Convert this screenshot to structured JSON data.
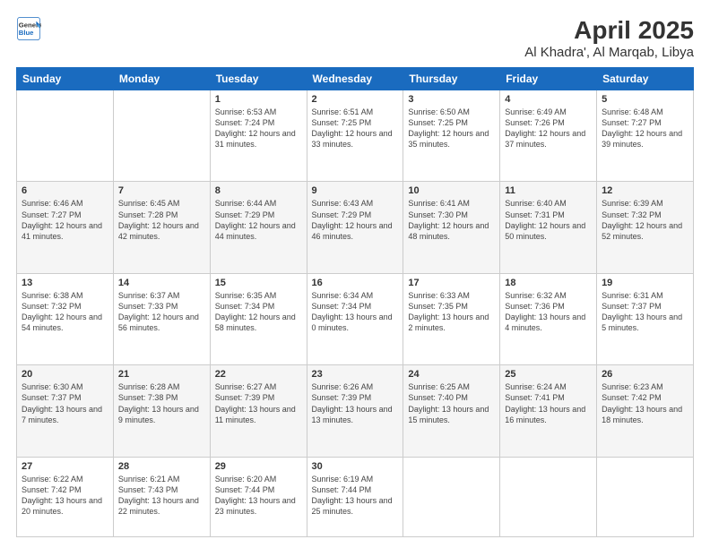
{
  "logo": {
    "line1": "General",
    "line2": "Blue"
  },
  "title": "April 2025",
  "subtitle": "Al Khadra', Al Marqab, Libya",
  "days": [
    "Sunday",
    "Monday",
    "Tuesday",
    "Wednesday",
    "Thursday",
    "Friday",
    "Saturday"
  ],
  "weeks": [
    [
      {
        "day": "",
        "sunrise": "",
        "sunset": "",
        "daylight": ""
      },
      {
        "day": "",
        "sunrise": "",
        "sunset": "",
        "daylight": ""
      },
      {
        "day": "1",
        "sunrise": "Sunrise: 6:53 AM",
        "sunset": "Sunset: 7:24 PM",
        "daylight": "Daylight: 12 hours and 31 minutes."
      },
      {
        "day": "2",
        "sunrise": "Sunrise: 6:51 AM",
        "sunset": "Sunset: 7:25 PM",
        "daylight": "Daylight: 12 hours and 33 minutes."
      },
      {
        "day": "3",
        "sunrise": "Sunrise: 6:50 AM",
        "sunset": "Sunset: 7:25 PM",
        "daylight": "Daylight: 12 hours and 35 minutes."
      },
      {
        "day": "4",
        "sunrise": "Sunrise: 6:49 AM",
        "sunset": "Sunset: 7:26 PM",
        "daylight": "Daylight: 12 hours and 37 minutes."
      },
      {
        "day": "5",
        "sunrise": "Sunrise: 6:48 AM",
        "sunset": "Sunset: 7:27 PM",
        "daylight": "Daylight: 12 hours and 39 minutes."
      }
    ],
    [
      {
        "day": "6",
        "sunrise": "Sunrise: 6:46 AM",
        "sunset": "Sunset: 7:27 PM",
        "daylight": "Daylight: 12 hours and 41 minutes."
      },
      {
        "day": "7",
        "sunrise": "Sunrise: 6:45 AM",
        "sunset": "Sunset: 7:28 PM",
        "daylight": "Daylight: 12 hours and 42 minutes."
      },
      {
        "day": "8",
        "sunrise": "Sunrise: 6:44 AM",
        "sunset": "Sunset: 7:29 PM",
        "daylight": "Daylight: 12 hours and 44 minutes."
      },
      {
        "day": "9",
        "sunrise": "Sunrise: 6:43 AM",
        "sunset": "Sunset: 7:29 PM",
        "daylight": "Daylight: 12 hours and 46 minutes."
      },
      {
        "day": "10",
        "sunrise": "Sunrise: 6:41 AM",
        "sunset": "Sunset: 7:30 PM",
        "daylight": "Daylight: 12 hours and 48 minutes."
      },
      {
        "day": "11",
        "sunrise": "Sunrise: 6:40 AM",
        "sunset": "Sunset: 7:31 PM",
        "daylight": "Daylight: 12 hours and 50 minutes."
      },
      {
        "day": "12",
        "sunrise": "Sunrise: 6:39 AM",
        "sunset": "Sunset: 7:32 PM",
        "daylight": "Daylight: 12 hours and 52 minutes."
      }
    ],
    [
      {
        "day": "13",
        "sunrise": "Sunrise: 6:38 AM",
        "sunset": "Sunset: 7:32 PM",
        "daylight": "Daylight: 12 hours and 54 minutes."
      },
      {
        "day": "14",
        "sunrise": "Sunrise: 6:37 AM",
        "sunset": "Sunset: 7:33 PM",
        "daylight": "Daylight: 12 hours and 56 minutes."
      },
      {
        "day": "15",
        "sunrise": "Sunrise: 6:35 AM",
        "sunset": "Sunset: 7:34 PM",
        "daylight": "Daylight: 12 hours and 58 minutes."
      },
      {
        "day": "16",
        "sunrise": "Sunrise: 6:34 AM",
        "sunset": "Sunset: 7:34 PM",
        "daylight": "Daylight: 13 hours and 0 minutes."
      },
      {
        "day": "17",
        "sunrise": "Sunrise: 6:33 AM",
        "sunset": "Sunset: 7:35 PM",
        "daylight": "Daylight: 13 hours and 2 minutes."
      },
      {
        "day": "18",
        "sunrise": "Sunrise: 6:32 AM",
        "sunset": "Sunset: 7:36 PM",
        "daylight": "Daylight: 13 hours and 4 minutes."
      },
      {
        "day": "19",
        "sunrise": "Sunrise: 6:31 AM",
        "sunset": "Sunset: 7:37 PM",
        "daylight": "Daylight: 13 hours and 5 minutes."
      }
    ],
    [
      {
        "day": "20",
        "sunrise": "Sunrise: 6:30 AM",
        "sunset": "Sunset: 7:37 PM",
        "daylight": "Daylight: 13 hours and 7 minutes."
      },
      {
        "day": "21",
        "sunrise": "Sunrise: 6:28 AM",
        "sunset": "Sunset: 7:38 PM",
        "daylight": "Daylight: 13 hours and 9 minutes."
      },
      {
        "day": "22",
        "sunrise": "Sunrise: 6:27 AM",
        "sunset": "Sunset: 7:39 PM",
        "daylight": "Daylight: 13 hours and 11 minutes."
      },
      {
        "day": "23",
        "sunrise": "Sunrise: 6:26 AM",
        "sunset": "Sunset: 7:39 PM",
        "daylight": "Daylight: 13 hours and 13 minutes."
      },
      {
        "day": "24",
        "sunrise": "Sunrise: 6:25 AM",
        "sunset": "Sunset: 7:40 PM",
        "daylight": "Daylight: 13 hours and 15 minutes."
      },
      {
        "day": "25",
        "sunrise": "Sunrise: 6:24 AM",
        "sunset": "Sunset: 7:41 PM",
        "daylight": "Daylight: 13 hours and 16 minutes."
      },
      {
        "day": "26",
        "sunrise": "Sunrise: 6:23 AM",
        "sunset": "Sunset: 7:42 PM",
        "daylight": "Daylight: 13 hours and 18 minutes."
      }
    ],
    [
      {
        "day": "27",
        "sunrise": "Sunrise: 6:22 AM",
        "sunset": "Sunset: 7:42 PM",
        "daylight": "Daylight: 13 hours and 20 minutes."
      },
      {
        "day": "28",
        "sunrise": "Sunrise: 6:21 AM",
        "sunset": "Sunset: 7:43 PM",
        "daylight": "Daylight: 13 hours and 22 minutes."
      },
      {
        "day": "29",
        "sunrise": "Sunrise: 6:20 AM",
        "sunset": "Sunset: 7:44 PM",
        "daylight": "Daylight: 13 hours and 23 minutes."
      },
      {
        "day": "30",
        "sunrise": "Sunrise: 6:19 AM",
        "sunset": "Sunset: 7:44 PM",
        "daylight": "Daylight: 13 hours and 25 minutes."
      },
      {
        "day": "",
        "sunrise": "",
        "sunset": "",
        "daylight": ""
      },
      {
        "day": "",
        "sunrise": "",
        "sunset": "",
        "daylight": ""
      },
      {
        "day": "",
        "sunrise": "",
        "sunset": "",
        "daylight": ""
      }
    ]
  ]
}
